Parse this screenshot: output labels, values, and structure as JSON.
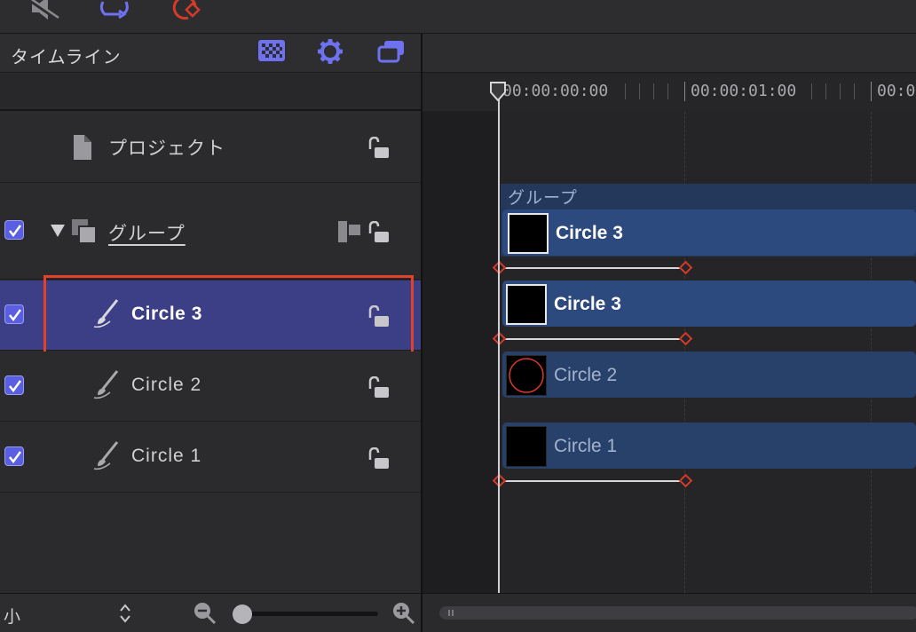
{
  "panel": {
    "title": "タイムライン"
  },
  "layers": {
    "project": {
      "label": "プロジェクト"
    },
    "group": {
      "label": "グループ",
      "checked": true
    },
    "items": [
      {
        "label": "Circle 3",
        "checked": true,
        "selected": true
      },
      {
        "label": "Circle 2",
        "checked": true,
        "selected": false
      },
      {
        "label": "Circle 1",
        "checked": true,
        "selected": false
      }
    ]
  },
  "ruler": {
    "timecodes": [
      "00:00:00:00",
      "00:00:01:00",
      "00:0"
    ]
  },
  "tracks": {
    "group_label": "グループ",
    "group_clip_label": "Circle 3",
    "clips": [
      {
        "label": "Circle 3"
      },
      {
        "label": "Circle 2"
      },
      {
        "label": "Circle 1"
      }
    ]
  },
  "footer": {
    "size_label": "小",
    "zoom_level": 0.0
  },
  "colors": {
    "selection": "#3d3f86",
    "highlight_box": "#e2412a",
    "clip": "#2d4a7e",
    "keyframe": "#d53a2a",
    "checkbox": "#5a5ee0",
    "toolbar_icon": "#6f72f0"
  },
  "icons": {
    "toolbar": [
      "mute-icon",
      "loop-icon",
      "record-keyframe-icon"
    ],
    "panel_header": [
      "checkerboard-icon",
      "gear-icon",
      "stacked-windows-icon"
    ]
  }
}
